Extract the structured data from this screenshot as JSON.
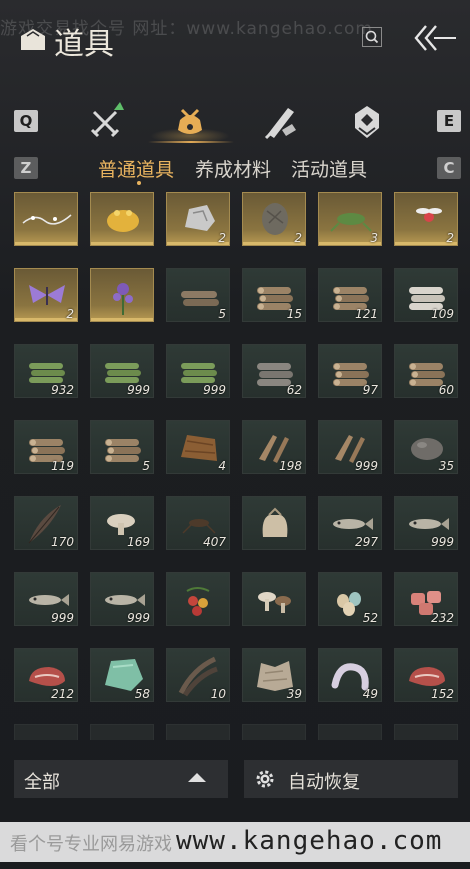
{
  "watermark_top": "游戏交易找个号   网址：www.kangehao.com",
  "header": {
    "title": "道具"
  },
  "category_keys": {
    "left": "Q",
    "right": "E"
  },
  "categories": [
    {
      "icon": "crossed-swords-icon"
    },
    {
      "icon": "pouch-icon",
      "active": true
    },
    {
      "icon": "scroll-brush-icon"
    },
    {
      "icon": "badge-icon"
    }
  ],
  "subtab_keys": {
    "left": "Z",
    "right": "C"
  },
  "subtabs": [
    {
      "label": "普通道具",
      "active": true
    },
    {
      "label": "养成材料"
    },
    {
      "label": "活动道具"
    }
  ],
  "items": [
    {
      "icon": "silver-thread-icon",
      "count": "",
      "rarity": "gold"
    },
    {
      "icon": "golden-toad-icon",
      "count": "",
      "rarity": "gold"
    },
    {
      "icon": "silver-ore-icon",
      "count": "2",
      "rarity": "gold"
    },
    {
      "icon": "rough-stone-icon",
      "count": "2",
      "rarity": "gold"
    },
    {
      "icon": "green-cricket-icon",
      "count": "3",
      "rarity": "gold"
    },
    {
      "icon": "firefly-icon",
      "count": "2",
      "rarity": "gold"
    },
    {
      "icon": "purple-moth-icon",
      "count": "2",
      "rarity": "gold"
    },
    {
      "icon": "purple-flower-icon",
      "count": "",
      "rarity": "gold"
    },
    {
      "icon": "log-bundle-icon",
      "count": "5",
      "rarity": ""
    },
    {
      "icon": "log-pile-icon",
      "count": "15",
      "rarity": ""
    },
    {
      "icon": "log-pile-icon",
      "count": "121",
      "rarity": ""
    },
    {
      "icon": "white-log-icon",
      "count": "109",
      "rarity": ""
    },
    {
      "icon": "bamboo-bundle-icon",
      "count": "932",
      "rarity": ""
    },
    {
      "icon": "bamboo-bundle-icon",
      "count": "999",
      "rarity": ""
    },
    {
      "icon": "bamboo-bundle-icon",
      "count": "999",
      "rarity": ""
    },
    {
      "icon": "grey-log-icon",
      "count": "62",
      "rarity": ""
    },
    {
      "icon": "log-pile-icon",
      "count": "97",
      "rarity": ""
    },
    {
      "icon": "log-pile-icon",
      "count": "60",
      "rarity": ""
    },
    {
      "icon": "log-pile-icon",
      "count": "119",
      "rarity": ""
    },
    {
      "icon": "log-pile-icon",
      "count": "5",
      "rarity": ""
    },
    {
      "icon": "bark-chunk-icon",
      "count": "4",
      "rarity": ""
    },
    {
      "icon": "firewood-icon",
      "count": "198",
      "rarity": ""
    },
    {
      "icon": "firewood-icon",
      "count": "999",
      "rarity": ""
    },
    {
      "icon": "grey-stone-icon",
      "count": "35",
      "rarity": ""
    },
    {
      "icon": "feather-icon",
      "count": "170",
      "rarity": ""
    },
    {
      "icon": "mushroom-icon",
      "count": "169",
      "rarity": ""
    },
    {
      "icon": "cricket-icon",
      "count": "407",
      "rarity": ""
    },
    {
      "icon": "grain-sack-icon",
      "count": "",
      "rarity": ""
    },
    {
      "icon": "fish-icon",
      "count": "297",
      "rarity": ""
    },
    {
      "icon": "fish-icon",
      "count": "999",
      "rarity": ""
    },
    {
      "icon": "fish-icon",
      "count": "999",
      "rarity": ""
    },
    {
      "icon": "fish-icon",
      "count": "999",
      "rarity": ""
    },
    {
      "icon": "berries-icon",
      "count": "",
      "rarity": ""
    },
    {
      "icon": "mushrooms-icon",
      "count": "",
      "rarity": ""
    },
    {
      "icon": "eggs-icon",
      "count": "52",
      "rarity": ""
    },
    {
      "icon": "meat-chunks-icon",
      "count": "232",
      "rarity": ""
    },
    {
      "icon": "steak-icon",
      "count": "212",
      "rarity": ""
    },
    {
      "icon": "jade-stone-icon",
      "count": "58",
      "rarity": ""
    },
    {
      "icon": "feathers-icon",
      "count": "10",
      "rarity": ""
    },
    {
      "icon": "fur-pelt-icon",
      "count": "39",
      "rarity": ""
    },
    {
      "icon": "sausage-icon",
      "count": "49",
      "rarity": ""
    },
    {
      "icon": "steak-icon",
      "count": "152",
      "rarity": ""
    }
  ],
  "bottom": {
    "filter_label": "全部",
    "auto_label": "自动恢复"
  },
  "watermark_bottom": {
    "cn": "看个号专业网易游戏 ",
    "url": "www.kangehao.com"
  }
}
